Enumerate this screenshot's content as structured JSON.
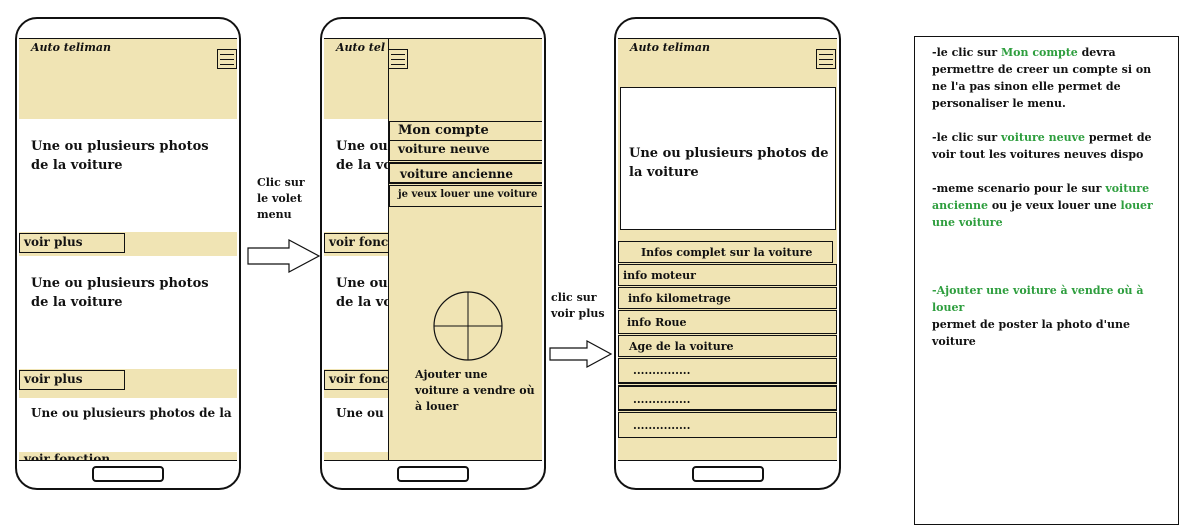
{
  "app_title": "Auto teliman",
  "phone1": {
    "photo_text": "Une ou plusieurs photos de la voiture",
    "see_more": "voir plus",
    "cut_photo_text": "Une ou plusieurs photos de la",
    "cut_button": "voir fonction"
  },
  "phone2": {
    "title_partial": "Auto tel",
    "photo_text": "Une ou plusieurs photos de la voiture",
    "button_partial": "voir fonc",
    "cut_photo_text": "Une ou",
    "menu": [
      "Mon compte",
      "voiture neuve",
      "voiture ancienne",
      "je veux louer une voiture"
    ],
    "add_car_text": "Ajouter une voiture a vendre où à louer"
  },
  "phone3": {
    "photo_text": "Une ou plusieurs photos de la voiture",
    "info_header": "Infos complet sur la voiture",
    "info_items": [
      "info moteur",
      "info kilometrage",
      "info Roue",
      "Age de la voiture",
      "...............",
      "...............",
      "..............."
    ]
  },
  "arrow1_caption": "Clic sur le volet menu",
  "arrow2_caption": "clic sur voir plus",
  "notes": {
    "n1_prefix": "-le clic sur ",
    "n1_green": "Mon compte",
    "n1_rest": " devra permettre de creer un compte si on ne l'a pas sinon elle permet de personaliser le menu.",
    "n2_prefix": "-le clic sur ",
    "n2_green": "voiture neuve",
    "n2_rest": " permet de voir tout les voitures neuves dispo",
    "n3_prefix": "-meme scenario pour le sur ",
    "n3_green1": "voiture ancienne",
    "n3_mid": " ou je veux louer une ",
    "n3_green2": "louer une voiture",
    "n4_green": "-Ajouter une voiture à vendre où à louer",
    "n4_rest": "permet de poster la photo d'une voiture"
  },
  "colors": {
    "panel": "#f0e4b4",
    "accent_green": "#2e9e3e",
    "line": "#111111"
  }
}
